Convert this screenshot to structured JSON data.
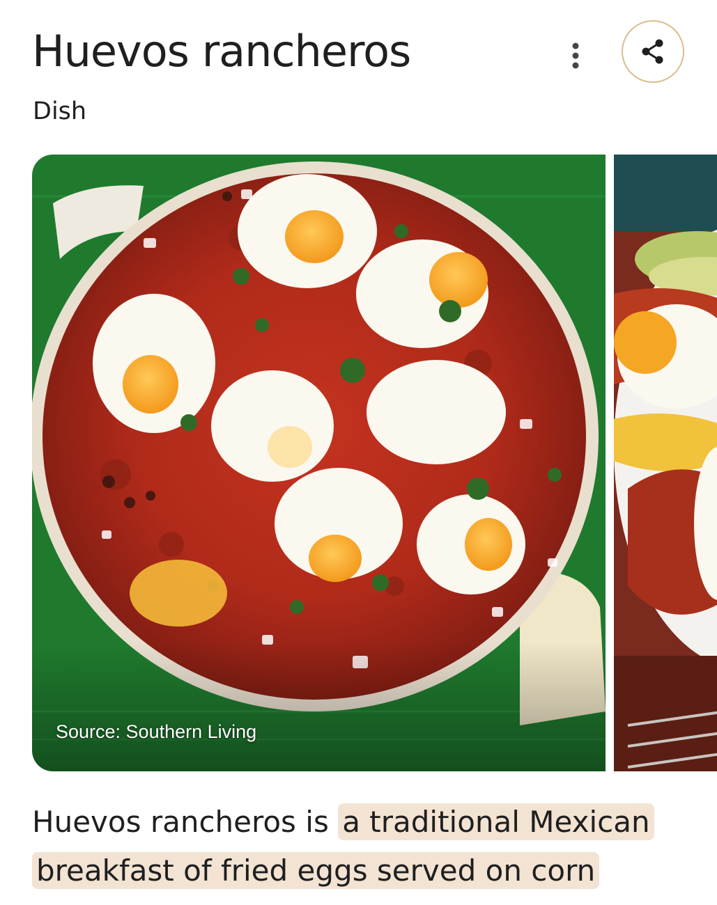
{
  "header": {
    "title": "Huevos rancheros",
    "subtitle": "Dish",
    "more_icon": "more-vert-icon",
    "share_icon": "share-icon",
    "share_border_color": "#d9bd8f"
  },
  "gallery": {
    "images": [
      {
        "source_label": "Source: Southern Living"
      }
    ]
  },
  "description": {
    "plain_text": "Huevos rancheros is ",
    "highlighted_text": "a traditional Mexican breakfast of fried eggs served on corn",
    "highlight_color": "#f2e3d3"
  }
}
